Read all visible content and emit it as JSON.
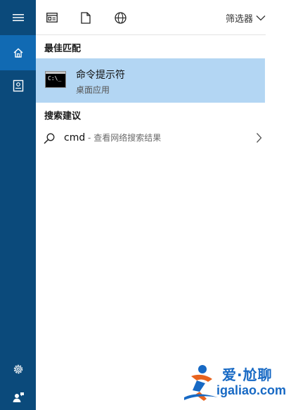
{
  "rail": {
    "items": [
      {
        "icon": "hamburger-menu-icon"
      },
      {
        "icon": "home-icon"
      },
      {
        "icon": "notebook-icon"
      }
    ],
    "bottom": [
      {
        "icon": "gear-icon"
      },
      {
        "icon": "user-feedback-icon"
      }
    ]
  },
  "toolbar": {
    "icons": [
      "apps-icon",
      "document-icon",
      "web-globe-icon"
    ],
    "filter_label": "筛选器"
  },
  "best_match": {
    "heading": "最佳匹配",
    "name": "命令提示符",
    "type": "桌面应用",
    "thumb_text": "C:\\_"
  },
  "suggestions": {
    "heading": "搜索建议",
    "items": [
      {
        "query": "cmd",
        "hint": " - 查看网络搜索结果"
      }
    ]
  },
  "watermark": {
    "cn": "爱·尬聊",
    "en": "igaliao.com"
  },
  "colors": {
    "rail": "#0b4a7b",
    "rail_active": "#116ab3",
    "selection": "#b3d6f3",
    "logo": "#1769c4"
  }
}
